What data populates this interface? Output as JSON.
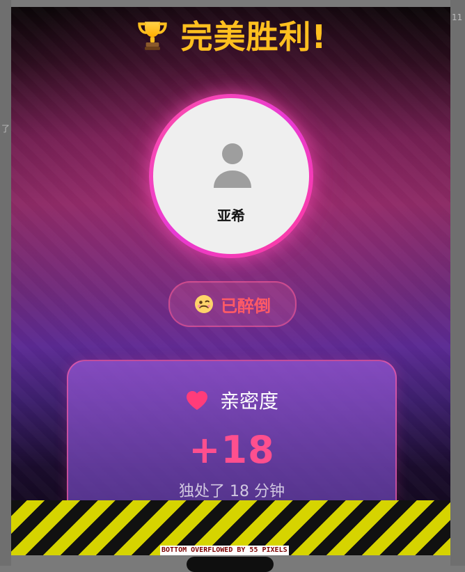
{
  "title": {
    "icon": "trophy-icon",
    "text": "完美胜利!",
    "color": "#ffbf1f"
  },
  "profile": {
    "name": "亚希",
    "avatar_icon": "person-icon"
  },
  "status": {
    "emoji_icon": "woozy-face-icon",
    "label": "已醉倒",
    "color": "#ff5a66"
  },
  "intimacy_card": {
    "icon": "heart-icon",
    "label": "亲密度",
    "value": "+18",
    "subtext": "独处了 18 分钟",
    "accent": "#ff4f8e"
  },
  "debug": {
    "overflow_text": "BOTTOM OVERFLOWED BY 55 PIXELS"
  },
  "background_edges": {
    "right_top": "11",
    "left_mid": "了"
  }
}
